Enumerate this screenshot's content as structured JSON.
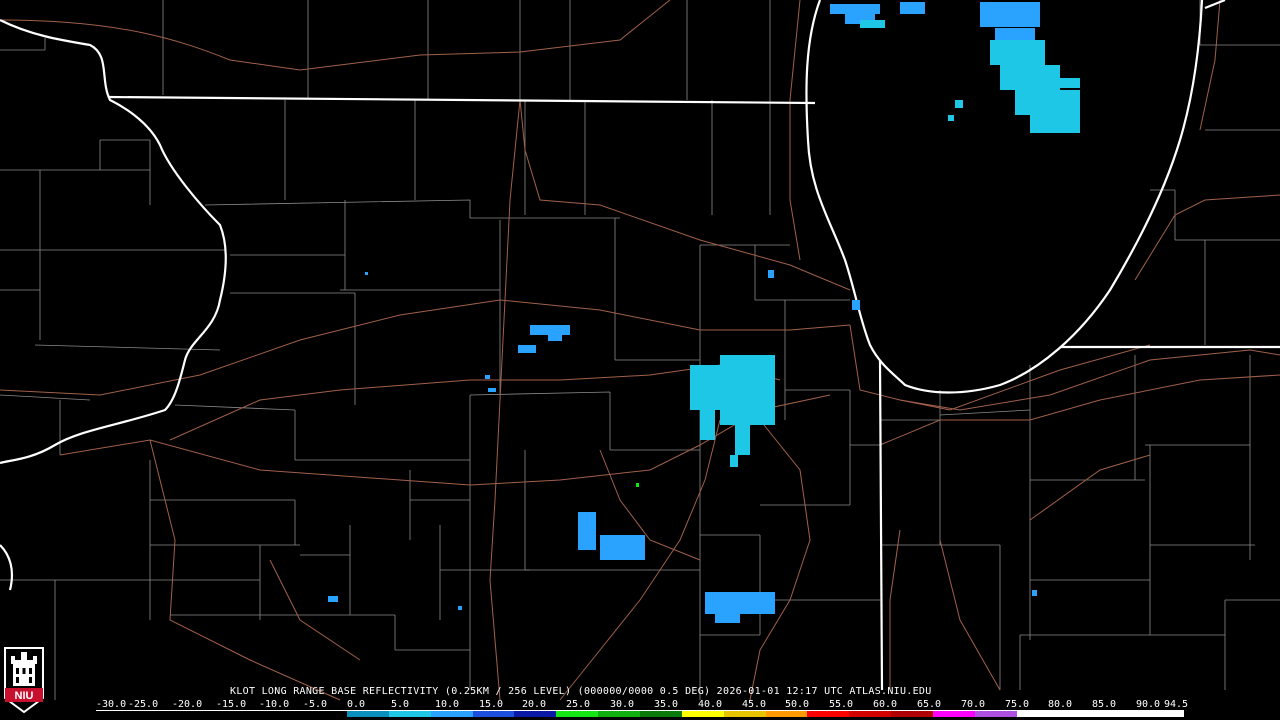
{
  "product": {
    "caption": "KLOT LONG RANGE BASE REFLECTIVITY (0.25KM / 256 LEVEL) (000000/0000 0.5 DEG) 2026-01-01 12:17 UTC  ATLAS.NIU.EDU"
  },
  "scale": {
    "labels": [
      "-30.0",
      "-25.0",
      "-20.0",
      "-15.0",
      "-10.0",
      "-5.0",
      "0.0",
      "5.0",
      "10.0",
      "15.0",
      "20.0",
      "25.0",
      "30.0",
      "35.0",
      "40.0",
      "45.0",
      "50.0",
      "55.0",
      "60.0",
      "65.0",
      "70.0",
      "75.0",
      "80.0",
      "85.0",
      "90.0",
      "94.5"
    ],
    "colors": [
      "#000000",
      "#000000",
      "#000000",
      "#000000",
      "#000000",
      "#000000",
      "#0a8fbf",
      "#1fc7e6",
      "#29a3ff",
      "#1c4fe0",
      "#0a18a8",
      "#14e614",
      "#10b010",
      "#0a7a0a",
      "#ffff00",
      "#e6c400",
      "#ff9a00",
      "#ff0000",
      "#d40000",
      "#b00000",
      "#ff00ff",
      "#b050e0",
      "#ffffff",
      "#ffffff",
      "#ffffff",
      "#ffffff"
    ]
  },
  "logo": {
    "text": "NIU",
    "color": "#c8102e"
  }
}
